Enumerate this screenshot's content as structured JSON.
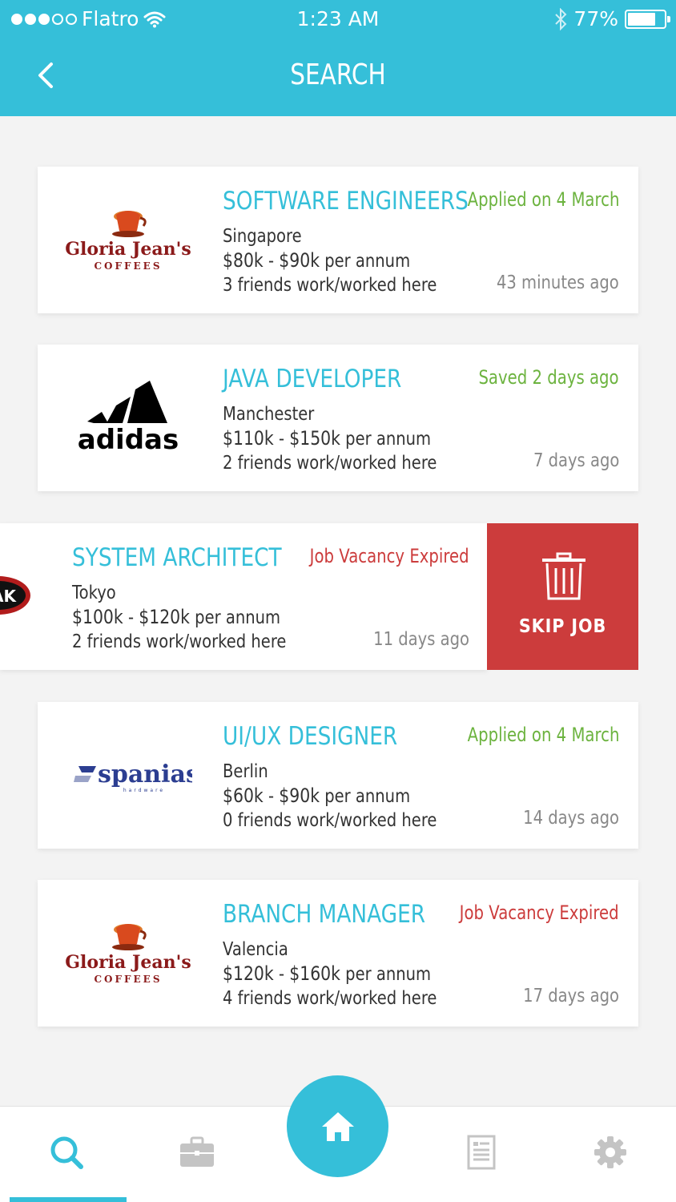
{
  "status_bar": {
    "carrier": "Flatro",
    "time": "1:23 AM",
    "battery": "77%",
    "battery_level": 0.77
  },
  "header": {
    "title": "SEARCH"
  },
  "jobs": [
    {
      "logo": "gloria-jeans-logo",
      "title": "SOFTWARE ENGINEERS",
      "status": "Applied on 4 March",
      "location": "Singapore",
      "salary_low": "$80k",
      "salary_sep": "-",
      "salary_high": "$90k",
      "salary_period": "per annum",
      "friends": "3",
      "friends_text": "friends work/worked here",
      "time": "43 minutes ago"
    },
    {
      "logo": "adidas-logo",
      "title": "JAVA DEVELOPER",
      "status": "Saved 2 days ago",
      "location": "Manchester",
      "salary_low": "$110k",
      "salary_sep": "-",
      "salary_high": "$150k",
      "salary_period": "per annum",
      "friends": "2",
      "friends_text": "friends work/worked here",
      "time": "7 days ago"
    },
    {
      "logo": "partial-logo",
      "logo_text": "AK",
      "title": "SYSTEM ARCHITECT",
      "status": "Job Vacancy Expired",
      "location": "Tokyo",
      "salary_low": "$100k",
      "salary_sep": "-",
      "salary_high": "$120k",
      "salary_period": "per annum",
      "friends": "2",
      "friends_text": "friends work/worked here",
      "time": "11 days ago"
    },
    {
      "logo": "spanias-logo",
      "title": "UI/UX DESIGNER",
      "status": "Applied on 4 March",
      "location": "Berlin",
      "salary_low": "$60k",
      "salary_sep": "-",
      "salary_high": "$90k",
      "salary_period": "per annum",
      "friends": "0",
      "friends_text": "friends work/worked here",
      "time": "14 days ago"
    },
    {
      "logo": "gloria-jeans-logo",
      "title": "BRANCH MANAGER",
      "status": "Job Vacancy Expired",
      "location": "Valencia",
      "salary_low": "$120k",
      "salary_sep": "-",
      "salary_high": "$160k",
      "salary_period": "per annum",
      "friends": "4",
      "friends_text": "friends work/worked here",
      "time": "17 days ago"
    }
  ],
  "logos": {
    "gloria_line1": "Gloria Jean's",
    "gloria_line2": "COFFEES",
    "adidas": "adidas",
    "spanias": "spanias",
    "spanias_sub": "hardware"
  },
  "skip": {
    "label": "SKIP JOB"
  },
  "colors": {
    "accent": "#35bfd9",
    "green": "#6cb33f",
    "red": "#cc3c3c"
  },
  "bottom_nav": {
    "items": [
      "search-icon",
      "briefcase-icon",
      "home-icon",
      "document-icon",
      "gear-icon"
    ],
    "active": "search"
  }
}
